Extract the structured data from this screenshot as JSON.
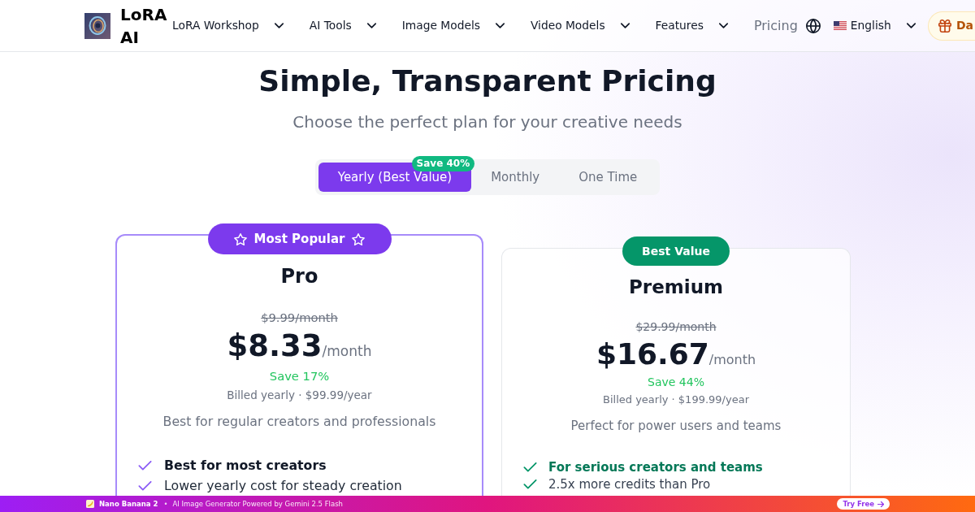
{
  "header": {
    "logo_text": "LoRA AI",
    "nav": [
      {
        "label": "LoRA Workshop",
        "kind": "dropdown"
      },
      {
        "label": "AI Tools",
        "kind": "dropdown"
      },
      {
        "label": "Image Models",
        "kind": "dropdown"
      },
      {
        "label": "Video Models",
        "kind": "dropdown"
      },
      {
        "label": "Features",
        "kind": "dropdown"
      },
      {
        "label": "Pricing",
        "kind": "link"
      }
    ],
    "language": {
      "label": "English"
    },
    "cta": {
      "label": "Da"
    }
  },
  "hero": {
    "title": "Simple, Transparent Pricing",
    "subtitle": "Choose the perfect plan for your creative needs"
  },
  "billing_tabs": [
    {
      "label": "Yearly (Best Value)",
      "selected": true,
      "badge": "Save 40%"
    },
    {
      "label": "Monthly",
      "selected": false
    },
    {
      "label": "One Time",
      "selected": false
    }
  ],
  "plans": [
    {
      "kind": "popular",
      "badge": "Most Popular",
      "name": "Pro",
      "original_price": "$9.99/month",
      "price": "$8.33",
      "period": "/month",
      "savings": "Save 17%",
      "billing": "Billed yearly · $99.99/year",
      "description": "Best for regular creators and professionals",
      "features": [
        {
          "text": "Best for most creators",
          "emphasized": true
        },
        {
          "text": "Lower yearly cost for steady creation",
          "emphasized": false
        }
      ]
    },
    {
      "kind": "value",
      "badge": "Best Value",
      "name": "Premium",
      "original_price": "$29.99/month",
      "price": "$16.67",
      "period": "/month",
      "savings": "Save 44%",
      "billing": "Billed yearly · $199.99/year",
      "description": "Perfect for power users and teams",
      "features": [
        {
          "text": "For serious creators and teams",
          "emphasized": true
        },
        {
          "text": "2.5x more credits than Pro",
          "emphasized": false
        }
      ]
    }
  ],
  "promo_bar": {
    "title": "Nano Banana 2",
    "separator": "•",
    "text": "AI Image Generator Powered by Gemini 2.5 Flash",
    "button": "Try Free"
  }
}
